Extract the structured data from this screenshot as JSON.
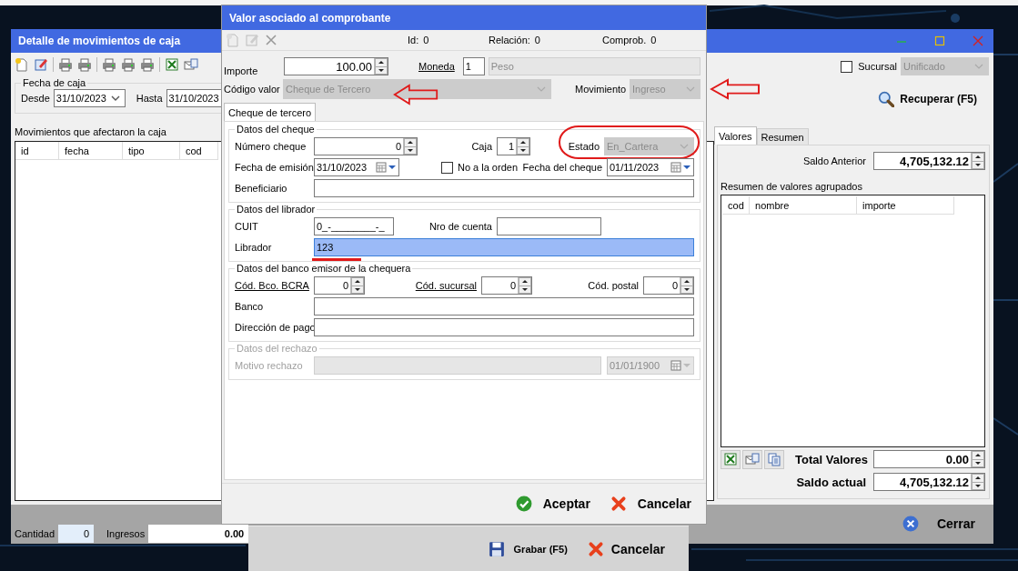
{
  "main_window": {
    "title": "Detalle de movimientos de caja",
    "sucursal": {
      "label": "Sucursal",
      "checked": false
    },
    "sucursal_combo": {
      "value": "Unificado",
      "disabled": true
    },
    "fecha_de_caja": {
      "legend": "Fecha de caja",
      "desde_label": "Desde",
      "desde": "31/10/2023",
      "hasta_label": "Hasta",
      "hasta": "31/10/2023"
    },
    "recuperar_button": "Recuperar (F5)",
    "movimientos": {
      "label": "Movimientos que afectaron la caja",
      "columns": [
        "id",
        "fecha",
        "tipo",
        "cod"
      ]
    },
    "tabs": [
      {
        "label": "Valores",
        "selected": true
      },
      {
        "label": "Resumen",
        "selected": false
      }
    ],
    "saldo_anterior": {
      "label": "Saldo Anterior",
      "value": "4,705,132.12"
    },
    "resumen": {
      "label": "Resumen de valores agrupados",
      "columns": [
        "cod",
        "nombre",
        "importe"
      ]
    },
    "total_valores": {
      "label": "Total Valores",
      "value": "0.00"
    },
    "saldo_actual": {
      "label": "Saldo actual",
      "value": "4,705,132.12"
    },
    "status_bar": {
      "cantidad": {
        "label": "Cantidad",
        "value": "0"
      },
      "ingresos": {
        "label": "Ingresos",
        "value": "0.00"
      }
    },
    "cerrar_button": "Cerrar"
  },
  "grabar_window": {
    "grabar_button": "Grabar (F5)",
    "cancelar_button": "Cancelar"
  },
  "dialog": {
    "title": "Valor asociado al comprobante",
    "info": [
      {
        "label": "Id:",
        "value": "0"
      },
      {
        "label": "Relación:",
        "value": "0"
      },
      {
        "label": "Comprob.",
        "value": "0"
      }
    ],
    "importe": {
      "label": "Importe",
      "value": "100.00"
    },
    "moneda": {
      "label": "Moneda",
      "code": "1",
      "name": "Peso",
      "disabled": true
    },
    "codigo_valor": {
      "label": "Código valor",
      "value": "Cheque de Tercero",
      "disabled": true,
      "annotation": {
        "kind": "arrow"
      }
    },
    "movimiento": {
      "label": "Movimiento",
      "value": "Ingreso",
      "disabled": true,
      "annotation": {
        "kind": "arrow"
      }
    },
    "tabs": [
      {
        "label": "Cheque de tercero",
        "selected": true
      }
    ],
    "groups": [
      {
        "legend": "Datos del cheque",
        "disabled": false,
        "rows": [
          [
            {
              "kind": "spin",
              "label": "Número cheque",
              "value": "0"
            },
            {
              "kind": "spin",
              "label": "Caja",
              "value": "1"
            },
            {
              "kind": "combo",
              "label": "Estado",
              "value": "En_Cartera",
              "disabled": true,
              "annotation": {
                "kind": "ellipse"
              }
            }
          ],
          [
            {
              "kind": "date",
              "label": "Fecha de emisión",
              "value": "31/10/2023"
            },
            {
              "kind": "check",
              "label": "No a la orden",
              "checked": false
            },
            {
              "kind": "date",
              "label": "Fecha del cheque",
              "value": "01/11/2023"
            }
          ],
          [
            {
              "kind": "text",
              "label": "Beneficiario"
            }
          ]
        ]
      },
      {
        "legend": "Datos del librador",
        "disabled": false,
        "rows": [
          [
            {
              "kind": "text",
              "label": "CUIT",
              "value": "0_-________-_"
            },
            {
              "kind": "text",
              "label": "Nro de cuenta"
            }
          ],
          [
            {
              "kind": "text",
              "label": "Librador",
              "value": "123",
              "selected": true,
              "annotation": {
                "kind": "underline"
              }
            }
          ]
        ]
      },
      {
        "legend": "Datos del banco emisor de la chequera",
        "disabled": false,
        "rows": [
          [
            {
              "kind": "spin",
              "label": "Cód. Bco. BCRA",
              "link": true,
              "value": "0"
            },
            {
              "kind": "spin",
              "label": "Cód. sucursal",
              "link": true,
              "value": "0"
            },
            {
              "kind": "spin",
              "label": "Cód. postal",
              "value": "0"
            }
          ],
          [
            {
              "kind": "text",
              "label": "Banco"
            }
          ],
          [
            {
              "kind": "text",
              "label": "Dirección de pago"
            }
          ]
        ]
      },
      {
        "legend": "Datos del rechazo",
        "disabled": true,
        "rows": [
          [
            {
              "kind": "text",
              "label": "Motivo rechazo"
            },
            {
              "kind": "date",
              "value": "01/01/1900"
            }
          ]
        ]
      }
    ],
    "buttons": [
      {
        "label": "Aceptar",
        "kind": "ok"
      },
      {
        "label": "Cancelar",
        "kind": "cancel"
      }
    ]
  }
}
